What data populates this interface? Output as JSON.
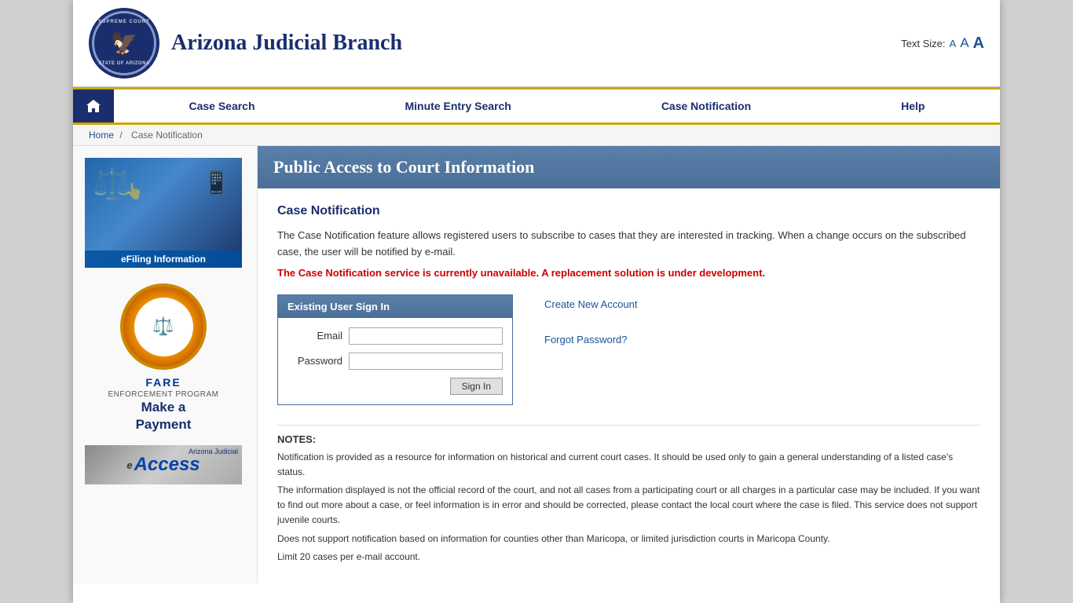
{
  "header": {
    "logo_alt": "Arizona Supreme Court Seal",
    "logo_text_top": "SUPREME COURT",
    "logo_text_bottom": "STATE OF ARIZONA",
    "site_title": "Arizona Judicial Branch",
    "text_size_label": "Text Size:",
    "text_size_a_small": "A",
    "text_size_a_medium": "A",
    "text_size_a_large": "A"
  },
  "nav": {
    "home_label": "Home",
    "items": [
      {
        "label": "Case Search",
        "id": "case-search"
      },
      {
        "label": "Minute Entry Search",
        "id": "minute-entry-search"
      },
      {
        "label": "Case Notification",
        "id": "case-notification"
      },
      {
        "label": "Help",
        "id": "help"
      }
    ]
  },
  "breadcrumb": {
    "home": "Home",
    "separator": "/",
    "current": "Case Notification"
  },
  "sidebar": {
    "efiling_label": "eFiling Information",
    "fare_label": "FARE",
    "fare_subtitle": "ENFORCEMENT PROGRAM",
    "make_payment_line1": "Make a",
    "make_payment_line2": "Payment",
    "eaccess_label": "eAccess",
    "eaccess_az": "Arizona Judicial"
  },
  "page": {
    "banner_title": "Public Access to Court Information",
    "section_title": "Case Notification",
    "description1": "The Case Notification feature allows registered users to subscribe to cases that they are interested in tracking. When a change occurs on the subscribed case, the user will be notified by e-mail.",
    "unavailable_notice": "The Case Notification service is currently unavailable. A replacement solution is under development.",
    "signin": {
      "header": "Existing User Sign In",
      "email_label": "Email",
      "password_label": "Password",
      "signin_btn": "Sign In"
    },
    "create_account_link": "Create New Account",
    "forgot_password_link": "Forgot Password?",
    "notes": {
      "title": "NOTES:",
      "note1": "Notification is provided as a resource for information on historical and current court cases. It should be used only to gain a general understanding of a listed case's status.",
      "note2": "The information displayed is not the official record of the court, and not all cases from a participating court or all charges in a particular case may be included. If you want to find out more about a case, or feel information is in error and should be corrected, please contact the local court where the case is filed. This service does not support juvenile courts.",
      "note3": "Does not support notification based on information for counties other than Maricopa, or limited jurisdiction courts in Maricopa County.",
      "note4": "Limit 20 cases per e-mail account."
    }
  }
}
